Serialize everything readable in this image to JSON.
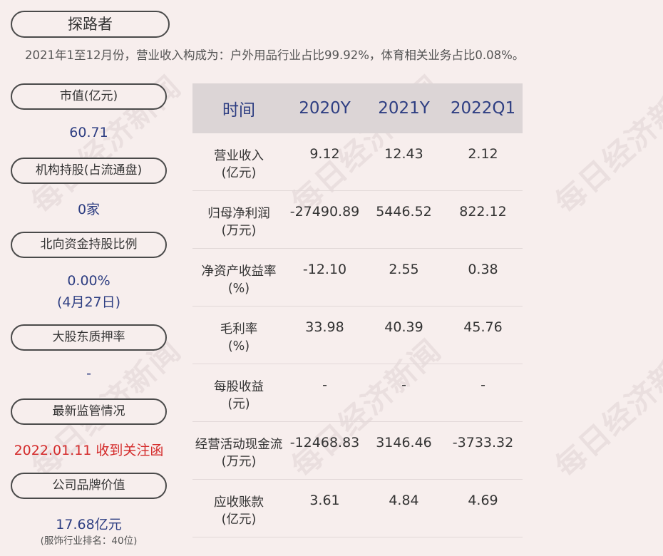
{
  "company": "探路者",
  "summary": "2021年1至12月份，营业收入构成为：户外用品行业占比99.92%，体育相关业务占比0.08%。",
  "left_panel": {
    "market_cap": {
      "label": "市值(亿元)",
      "value": "60.71"
    },
    "institution": {
      "label": "机构持股(占流通盘)",
      "value": "0家"
    },
    "northbound": {
      "label": "北向资金持股比例",
      "value": "0.00%",
      "note": "(4月27日)"
    },
    "pledge": {
      "label": "大股东质押率",
      "value": "-"
    },
    "regulation": {
      "label": "最新监管情况",
      "value": "2022.01.11 收到关注函"
    },
    "brand": {
      "label": "公司品牌价值",
      "value": "17.68亿元",
      "note": "(服饰行业排名：40位)"
    }
  },
  "table": {
    "headers": [
      "时间",
      "2020Y",
      "2021Y",
      "2022Q1"
    ],
    "rows": [
      {
        "name": "营业收入",
        "unit": "(亿元)",
        "values": [
          "9.12",
          "12.43",
          "2.12"
        ]
      },
      {
        "name": "归母净利润",
        "unit": "(万元)",
        "values": [
          "-27490.89",
          "5446.52",
          "822.12"
        ]
      },
      {
        "name": "净资产收益率",
        "unit": "(%)",
        "values": [
          "-12.10",
          "2.55",
          "0.38"
        ]
      },
      {
        "name": "毛利率",
        "unit": "(%)",
        "values": [
          "33.98",
          "40.39",
          "45.76"
        ]
      },
      {
        "name": "每股收益",
        "unit": "(元)",
        "values": [
          "-",
          "-",
          "-"
        ]
      },
      {
        "name": "经营活动现金流",
        "unit": "(万元)",
        "values": [
          "-12468.83",
          "3146.46",
          "-3733.32"
        ]
      },
      {
        "name": "应收账款",
        "unit": "(亿元)",
        "values": [
          "3.61",
          "4.84",
          "4.69"
        ]
      }
    ]
  },
  "watermark": "每日经济新闻",
  "colors": {
    "background": "#f7eeed",
    "value_blue": "#2e3e82",
    "alert_red": "#d42b2b",
    "header_bg": "#dcd5d6"
  }
}
